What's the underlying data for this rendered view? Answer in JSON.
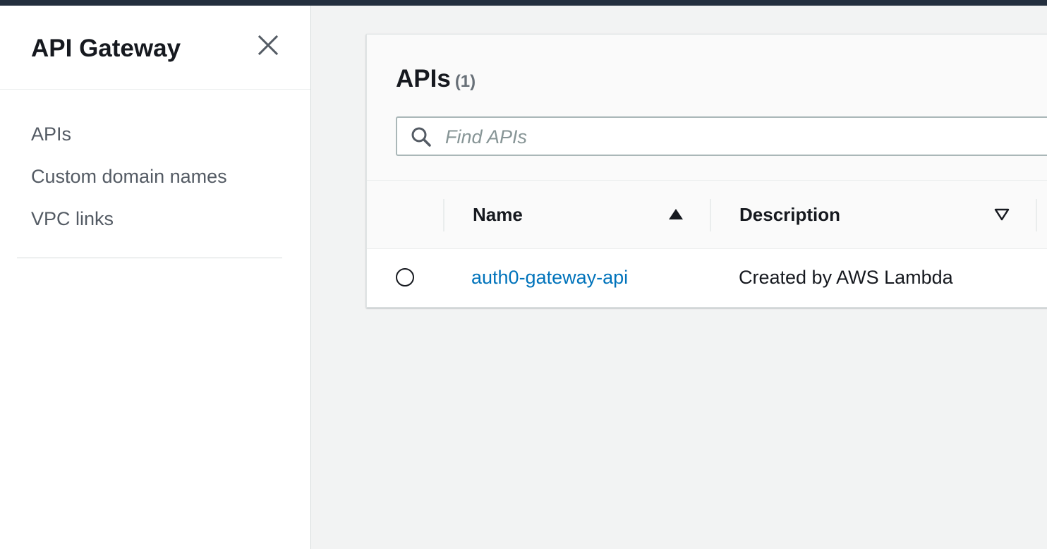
{
  "sidebar": {
    "title": "API Gateway",
    "close_icon": "close-icon",
    "items": [
      {
        "label": "APIs"
      },
      {
        "label": "Custom domain names"
      },
      {
        "label": "VPC links"
      }
    ]
  },
  "panel": {
    "title": "APIs",
    "count": "(1)",
    "search": {
      "placeholder": "Find APIs",
      "value": "",
      "icon": "search-icon"
    },
    "table": {
      "columns": [
        {
          "label": "Name",
          "sort": "ascending"
        },
        {
          "label": "Description",
          "sort": "none"
        }
      ],
      "rows": [
        {
          "selected": false,
          "name": "auth0-gateway-api",
          "description": "Created by AWS Lambda"
        }
      ]
    }
  },
  "colors": {
    "topbar": "#232f3e",
    "link": "#0073bb",
    "background": "#f2f3f3",
    "text": "#16191f",
    "nav_text": "#545b64"
  }
}
